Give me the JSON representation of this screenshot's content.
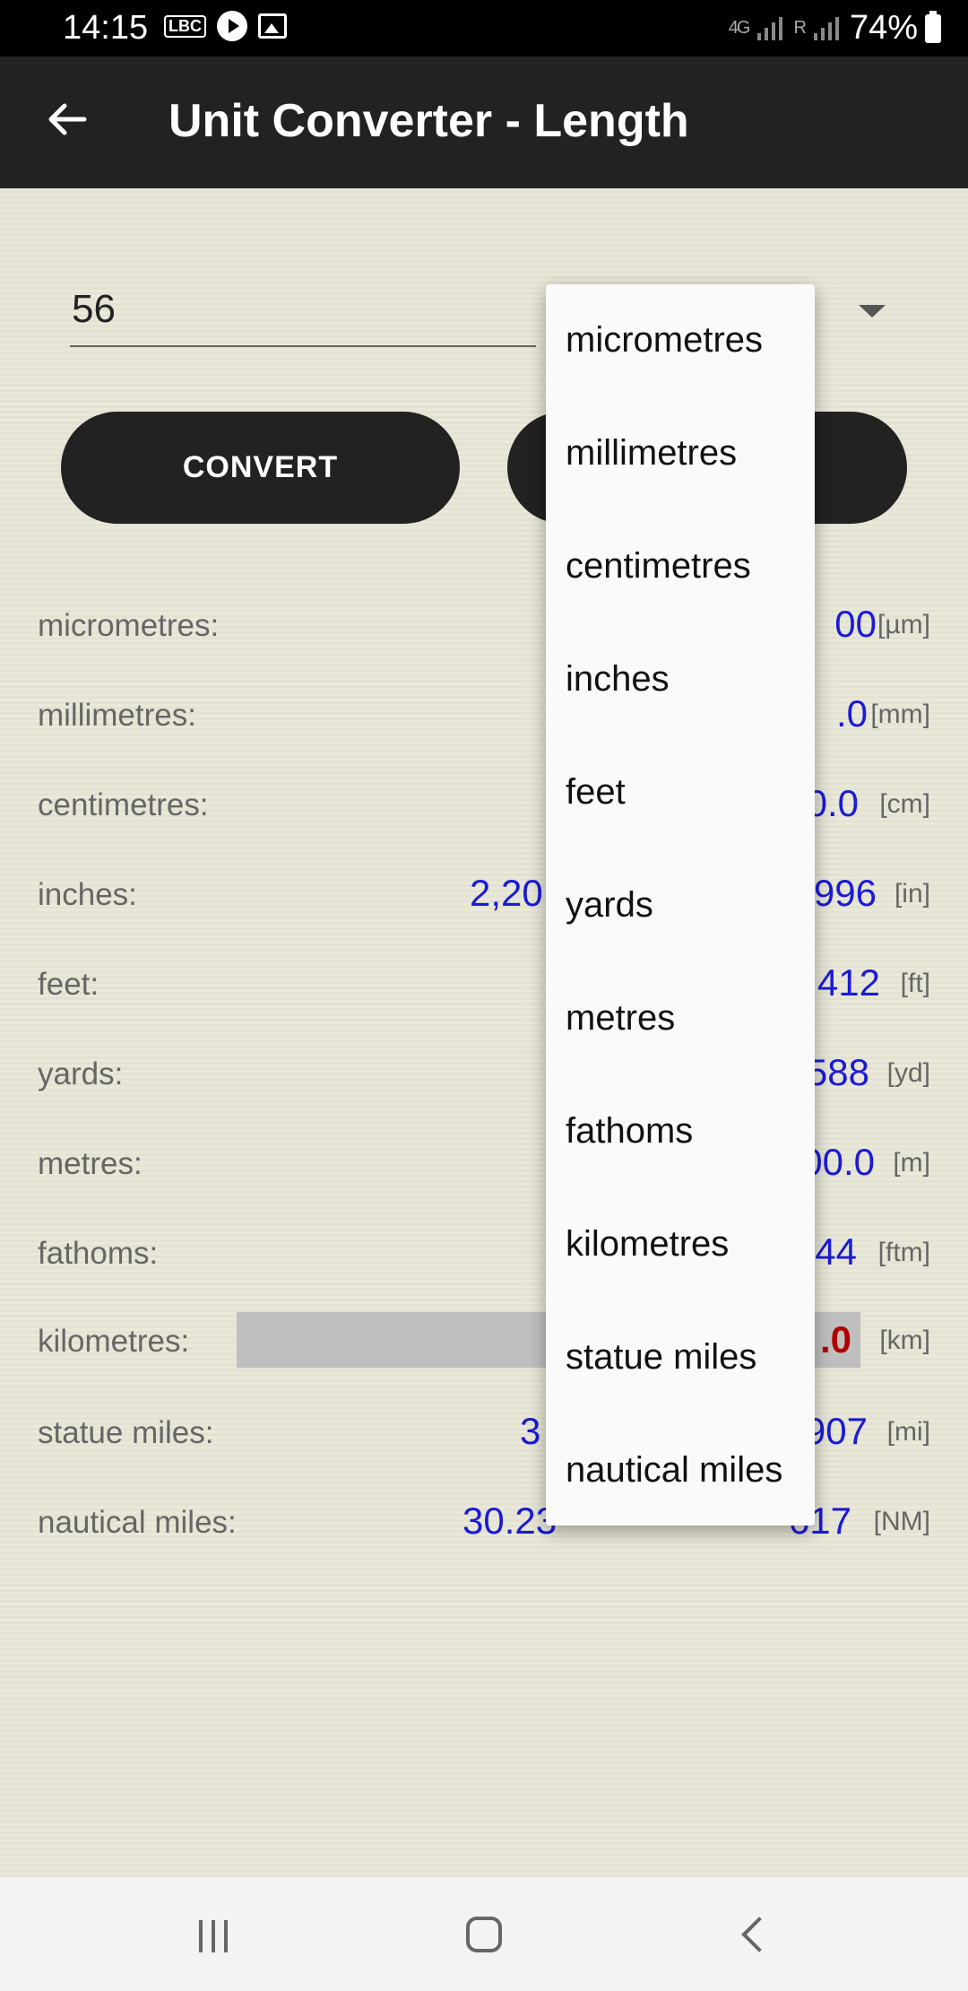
{
  "status_bar": {
    "time": "14:15",
    "lbc_label": "LBC",
    "network_label": "4G",
    "roaming_label": "R",
    "battery": "74%"
  },
  "app_bar": {
    "title": "Unit Converter - Length"
  },
  "input": {
    "value": "56"
  },
  "buttons": {
    "convert": "CONVERT"
  },
  "results": [
    {
      "label": "micrometres:",
      "value": "00",
      "unit": "[µm]"
    },
    {
      "label": "millimetres:",
      "value": ".0",
      "unit": "[mm]"
    },
    {
      "label": "centimetres:",
      "value": "0.0",
      "unit": "[cm]"
    },
    {
      "label": "inches:",
      "value_left": "2,20",
      "value": "996",
      "unit": "[in]"
    },
    {
      "label": "feet:",
      "value": "412",
      "unit": "[ft]"
    },
    {
      "label": "yards:",
      "value": "588",
      "unit": "[yd]"
    },
    {
      "label": "metres:",
      "value": "00.0",
      "unit": "[m]"
    },
    {
      "label": "fathoms:",
      "value": "44",
      "unit": "[ftm]"
    },
    {
      "label": "kilometres:",
      "value": ".0",
      "unit": "[km]"
    },
    {
      "label": "statue miles:",
      "value_left": "3",
      "value": "907",
      "unit": "[mi]"
    },
    {
      "label": "nautical miles:",
      "value": "30.23",
      "value_right": "617",
      "unit": "[NM]"
    }
  ],
  "dropdown": {
    "options": [
      "micrometres",
      "millimetres",
      "centimetres",
      "inches",
      "feet",
      "yards",
      "metres",
      "fathoms",
      "kilometres",
      "statue miles",
      "nautical miles"
    ]
  }
}
